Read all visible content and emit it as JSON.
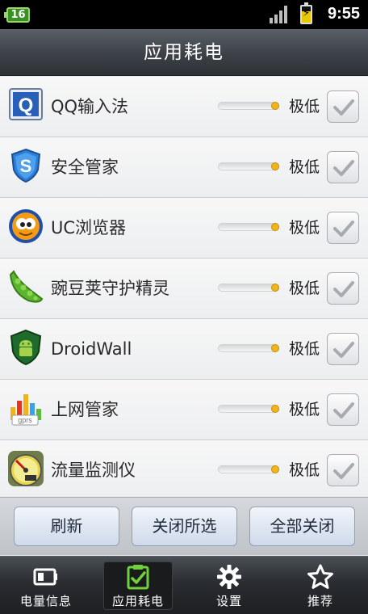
{
  "status_bar": {
    "battery_level": "16",
    "time": "9:55"
  },
  "header": {
    "title": "应用耗电"
  },
  "apps": [
    {
      "name": "QQ输入法",
      "usage": "极低",
      "icon": "qq-input-icon",
      "checked": true
    },
    {
      "name": "安全管家",
      "usage": "极低",
      "icon": "security-shield-icon",
      "checked": true
    },
    {
      "name": "UC浏览器",
      "usage": "极低",
      "icon": "uc-browser-icon",
      "checked": true
    },
    {
      "name": "豌豆荚守护精灵",
      "usage": "极低",
      "icon": "peapod-icon",
      "checked": true
    },
    {
      "name": "DroidWall",
      "usage": "极低",
      "icon": "android-shield-icon",
      "checked": true
    },
    {
      "name": "上网管家",
      "usage": "极低",
      "icon": "gprs-bars-icon",
      "checked": true
    },
    {
      "name": "流量监测仪",
      "usage": "极低",
      "icon": "speedometer-icon",
      "checked": true
    }
  ],
  "actions": {
    "refresh": "刷新",
    "close_selected": "关闭所选",
    "close_all": "全部关闭"
  },
  "bottom_nav": [
    {
      "label": "电量信息",
      "icon": "battery-icon",
      "active": false
    },
    {
      "label": "应用耗电",
      "icon": "clipboard-check-icon",
      "active": true
    },
    {
      "label": "设置",
      "icon": "gear-icon",
      "active": false
    },
    {
      "label": "推荐",
      "icon": "star-icon",
      "active": false
    }
  ],
  "colors": {
    "usage_dot": "#f0b51c",
    "title_bar": "#3c4147",
    "active_tab_icon": "#6fd23a"
  }
}
